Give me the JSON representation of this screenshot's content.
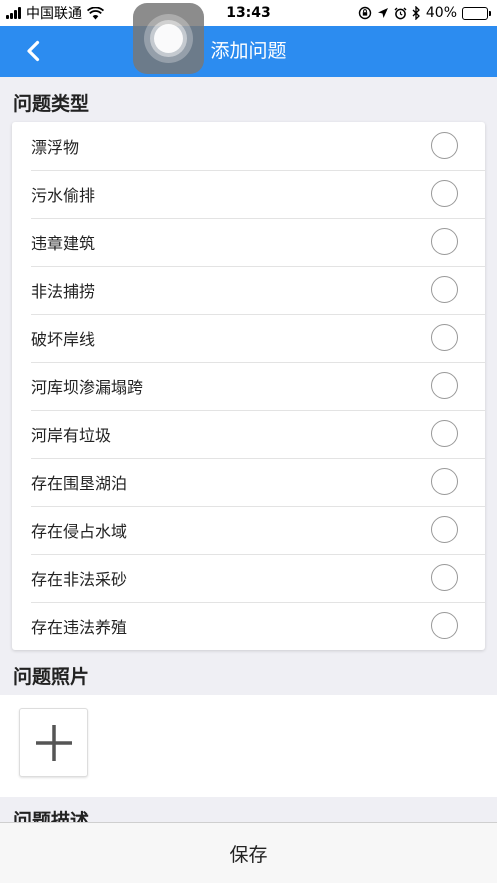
{
  "status_bar": {
    "carrier": "中国联通",
    "time": "13:43",
    "battery": "40%",
    "battery_level": 0.4
  },
  "nav": {
    "title": "添加问题"
  },
  "sections": {
    "problem_type": "问题类型",
    "problem_photo": "问题照片",
    "problem_description": "问题描述"
  },
  "problem_types": [
    {
      "label": "漂浮物"
    },
    {
      "label": "污水偷排"
    },
    {
      "label": "违章建筑"
    },
    {
      "label": "非法捕捞"
    },
    {
      "label": "破坏岸线"
    },
    {
      "label": "河库坝渗漏塌跨"
    },
    {
      "label": "河岸有垃圾"
    },
    {
      "label": "存在围垦湖泊"
    },
    {
      "label": "存在侵占水域"
    },
    {
      "label": "存在非法采砂"
    },
    {
      "label": "存在违法养殖"
    }
  ],
  "footer": {
    "save_label": "保存"
  },
  "colors": {
    "nav_bg": "#2c8cf0",
    "page_bg": "#efeff4",
    "battery_fill": "#4cd964"
  }
}
